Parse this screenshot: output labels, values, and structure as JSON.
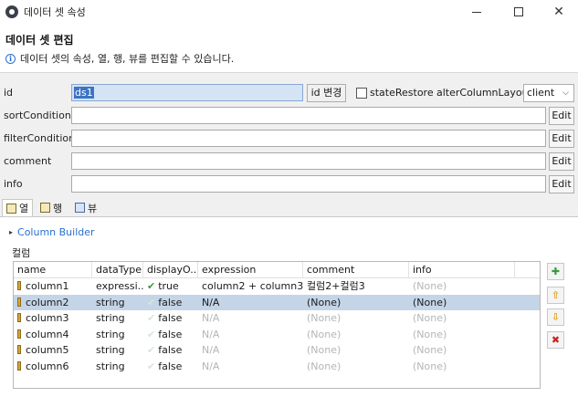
{
  "window": {
    "title": "데이터 셋 속성"
  },
  "header": {
    "title": "데이터 셋 편집",
    "description": "데이터 셋의 속성, 열, 행, 뷰를 편집할 수 있습니다."
  },
  "form": {
    "id_label": "id",
    "id_value": "ds1",
    "id_change_label": "id 변경",
    "state_restore_label": "stateRestore",
    "state_restore_checked": false,
    "alter_column_layout_label": "alterColumnLayout",
    "alter_column_layout_value": "client",
    "sort_condition_label": "sortCondition",
    "filter_condition_label": "filterCondition",
    "comment_label": "comment",
    "info_label": "info",
    "edit_label": "Edit"
  },
  "tabs": [
    {
      "label": "열",
      "active": true
    },
    {
      "label": "행",
      "active": false
    },
    {
      "label": "뷰",
      "active": false
    }
  ],
  "column_builder_label": "Column Builder",
  "section_label": "컬럼",
  "table": {
    "headers": [
      "name",
      "dataType",
      "displayO...",
      "expression",
      "comment",
      "info"
    ],
    "rows": [
      {
        "name": "column1",
        "dataType": "expressi...",
        "display": "true",
        "display_checked": true,
        "expression": "column2 + column3",
        "comment": "컬럼2+컬럼3",
        "info": "(None)",
        "selected": false
      },
      {
        "name": "column2",
        "dataType": "string",
        "display": "false",
        "display_checked": false,
        "expression": "N/A",
        "comment": "(None)",
        "info": "(None)",
        "selected": true
      },
      {
        "name": "column3",
        "dataType": "string",
        "display": "false",
        "display_checked": false,
        "expression": "N/A",
        "comment": "(None)",
        "info": "(None)",
        "selected": false
      },
      {
        "name": "column4",
        "dataType": "string",
        "display": "false",
        "display_checked": false,
        "expression": "N/A",
        "comment": "(None)",
        "info": "(None)",
        "selected": false
      },
      {
        "name": "column5",
        "dataType": "string",
        "display": "false",
        "display_checked": false,
        "expression": "N/A",
        "comment": "(None)",
        "info": "(None)",
        "selected": false
      },
      {
        "name": "column6",
        "dataType": "string",
        "display": "false",
        "display_checked": false,
        "expression": "N/A",
        "comment": "(None)",
        "info": "(None)",
        "selected": false
      }
    ]
  },
  "side_buttons": [
    "add-icon",
    "move-up-icon",
    "move-down-icon",
    "delete-icon"
  ],
  "colors": {
    "accent": "#2a6fcf",
    "selected_row": "#c5d5e8"
  }
}
